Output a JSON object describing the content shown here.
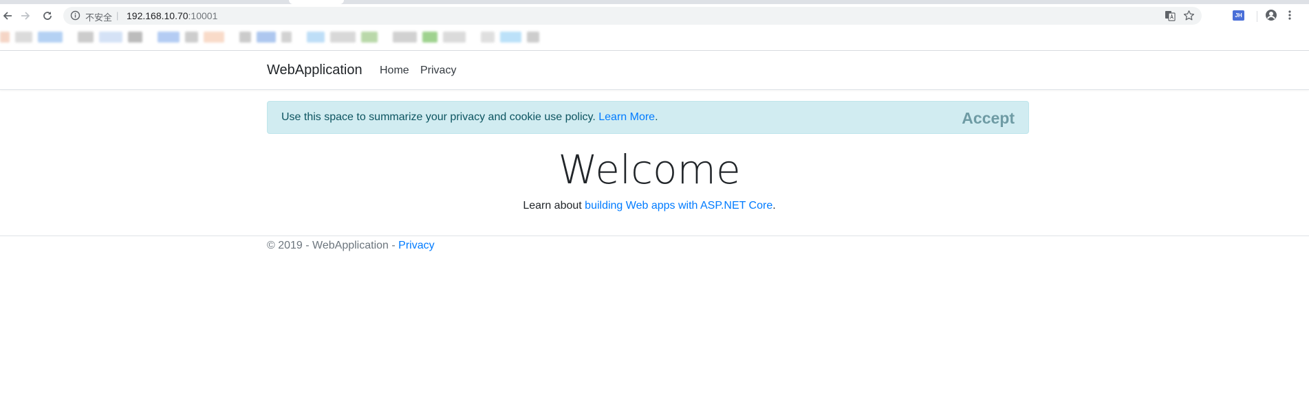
{
  "browser": {
    "security_label": "不安全",
    "separator": "|",
    "url_host": "192.168.10.70",
    "url_port": ":10001",
    "extension_badge": "JH"
  },
  "bookmarks_bar": {
    "colors": [
      "#f2c8b4",
      "#d0d0d0",
      "#9cc2f0",
      "#bbbbbb",
      "#c7d9f3",
      "#a6a6a6",
      "#9bbcef",
      "#bdbdbd",
      "#f7cfb8",
      "#bababa",
      "#93b5ea",
      "#c4c4c4",
      "#a9d4f5",
      "#cccccc",
      "#a3cc8e",
      "#c2c2c2",
      "#7fc46a",
      "#cfcfcf",
      "#d5d5d5",
      "#a6d8f7",
      "#bdbdbd"
    ]
  },
  "navbar": {
    "brand": "WebApplication",
    "links": [
      "Home",
      "Privacy"
    ]
  },
  "cookie_banner": {
    "message": "Use this space to summarize your privacy and cookie use policy.",
    "learn_more": "Learn More",
    "period": ".",
    "accept": "Accept"
  },
  "main": {
    "heading": "Welcome",
    "intro_prefix": "Learn about",
    "intro_link": "building Web apps with ASP.NET Core",
    "intro_suffix": "."
  },
  "footer": {
    "copyright": "© 2019 - WebApplication - ",
    "privacy_link": "Privacy"
  }
}
